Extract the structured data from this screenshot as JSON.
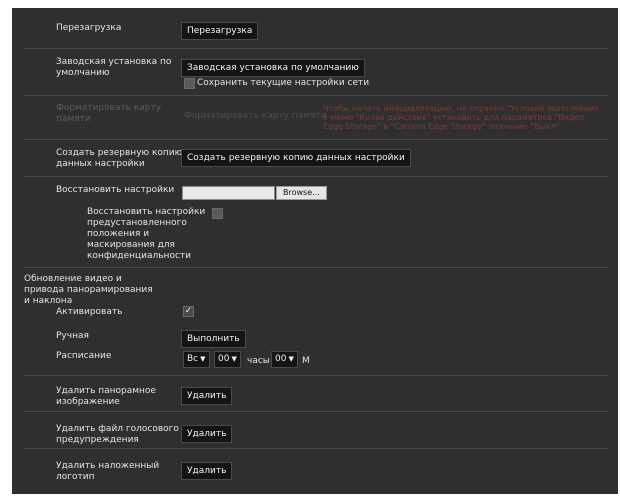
{
  "reboot": {
    "label": "Перезагрузка",
    "button": "Перезагрузка"
  },
  "factory_default": {
    "label_line1": "Заводская установка по",
    "label_line2": "умолчанию",
    "button": "Заводская установка по умолчанию",
    "keep_network_label": "Сохранить текущие настройки сети",
    "keep_network_checked": false
  },
  "format_card": {
    "label_line1": "Форматировать карту",
    "label_line2": "памяти",
    "button": "Форматировать карту памяти",
    "warning_line1": "Чтобы начать инициализацию, не охранно \"Условие выполнения",
    "warning_line2": "в меню \"Колав действие\" установить для параметров \"Видео",
    "warning_line3": "Edge Storage\" в \"Camera Edge Storage\" значение \"Выкл\"."
  },
  "backup": {
    "label_line1": "Создать резервную копию",
    "label_line2": "данных настройки",
    "button": "Создать резервную копию данных настройки"
  },
  "restore": {
    "label": "Восстановить настройки",
    "browse_button": "Browse...",
    "file_value": "",
    "preset_label_lines": [
      "Восстановить настройки",
      "предустановленного",
      "положения и",
      "маскирования для",
      "конфиденциальности"
    ],
    "preset_checked": false
  },
  "video_update": {
    "heading_lines": [
      "Обновление видео и",
      "привода панорамирования",
      "и наклона"
    ],
    "activate_label": "Активировать",
    "activate_checked": true,
    "manual_label": "Ручная",
    "execute_button": "Выполнить",
    "schedule_label": "Расписание",
    "day_value": "Вс",
    "hour_value": "00",
    "hours_unit": "часы",
    "minute_value": "00",
    "minutes_unit": "М"
  },
  "delete_panorama": {
    "label_line1": "Удалить панорамное",
    "label_line2": "изображение",
    "button": "Удалить"
  },
  "delete_voice": {
    "label_line1": "Удалить файл голосового",
    "label_line2": "предупреждения",
    "button": "Удалить"
  },
  "delete_logo": {
    "label_line1": "Удалить наложенный",
    "label_line2": "логотип",
    "button": "Удалить"
  },
  "colors": {
    "panel_bg": "#2f2f2f",
    "button_bg": "#141414",
    "warning": "#7a3a36"
  }
}
